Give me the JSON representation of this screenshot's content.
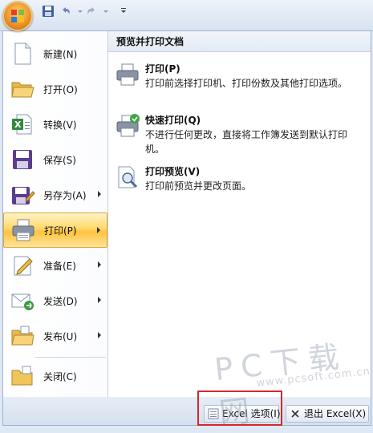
{
  "menu": {
    "items": [
      {
        "label": "新建(N)",
        "icon": "new-document-icon",
        "submenu": false
      },
      {
        "label": "打开(O)",
        "icon": "open-folder-icon",
        "submenu": false
      },
      {
        "label": "转换(V)",
        "icon": "convert-excel-icon",
        "submenu": false
      },
      {
        "label": "保存(S)",
        "icon": "save-disk-icon",
        "submenu": false
      },
      {
        "label": "另存为(A)",
        "icon": "save-as-icon",
        "submenu": true
      },
      {
        "label": "打印(P)",
        "icon": "printer-icon",
        "submenu": true,
        "active": true
      },
      {
        "label": "准备(E)",
        "icon": "prepare-icon",
        "submenu": true
      },
      {
        "label": "发送(D)",
        "icon": "send-icon",
        "submenu": true
      },
      {
        "label": "发布(U)",
        "icon": "publish-icon",
        "submenu": true
      },
      {
        "label": "关闭(C)",
        "icon": "close-folder-icon",
        "submenu": false
      }
    ]
  },
  "panel": {
    "heading": "预览并打印文档",
    "options": [
      {
        "title": "打印(P)",
        "desc": "打印前选择打印机、打印份数及其他打印选项。",
        "icon": "printer-icon"
      },
      {
        "title": "快速打印(Q)",
        "desc": "不进行任何更改，直接将工作簿发送到默认打印机。",
        "icon": "quick-print-icon"
      },
      {
        "title": "打印预览(V)",
        "desc": "打印前预览并更改页面。",
        "icon": "print-preview-icon"
      }
    ]
  },
  "footer": {
    "options_label": "Excel 选项(I)",
    "exit_label": "退出 Excel(X)"
  },
  "watermark": {
    "main": "PC下载网",
    "sub": "www.pcsoft.com.cn"
  },
  "colors": {
    "active_gradient": "#ffc33e",
    "highlight_box": "#d22a2a"
  }
}
